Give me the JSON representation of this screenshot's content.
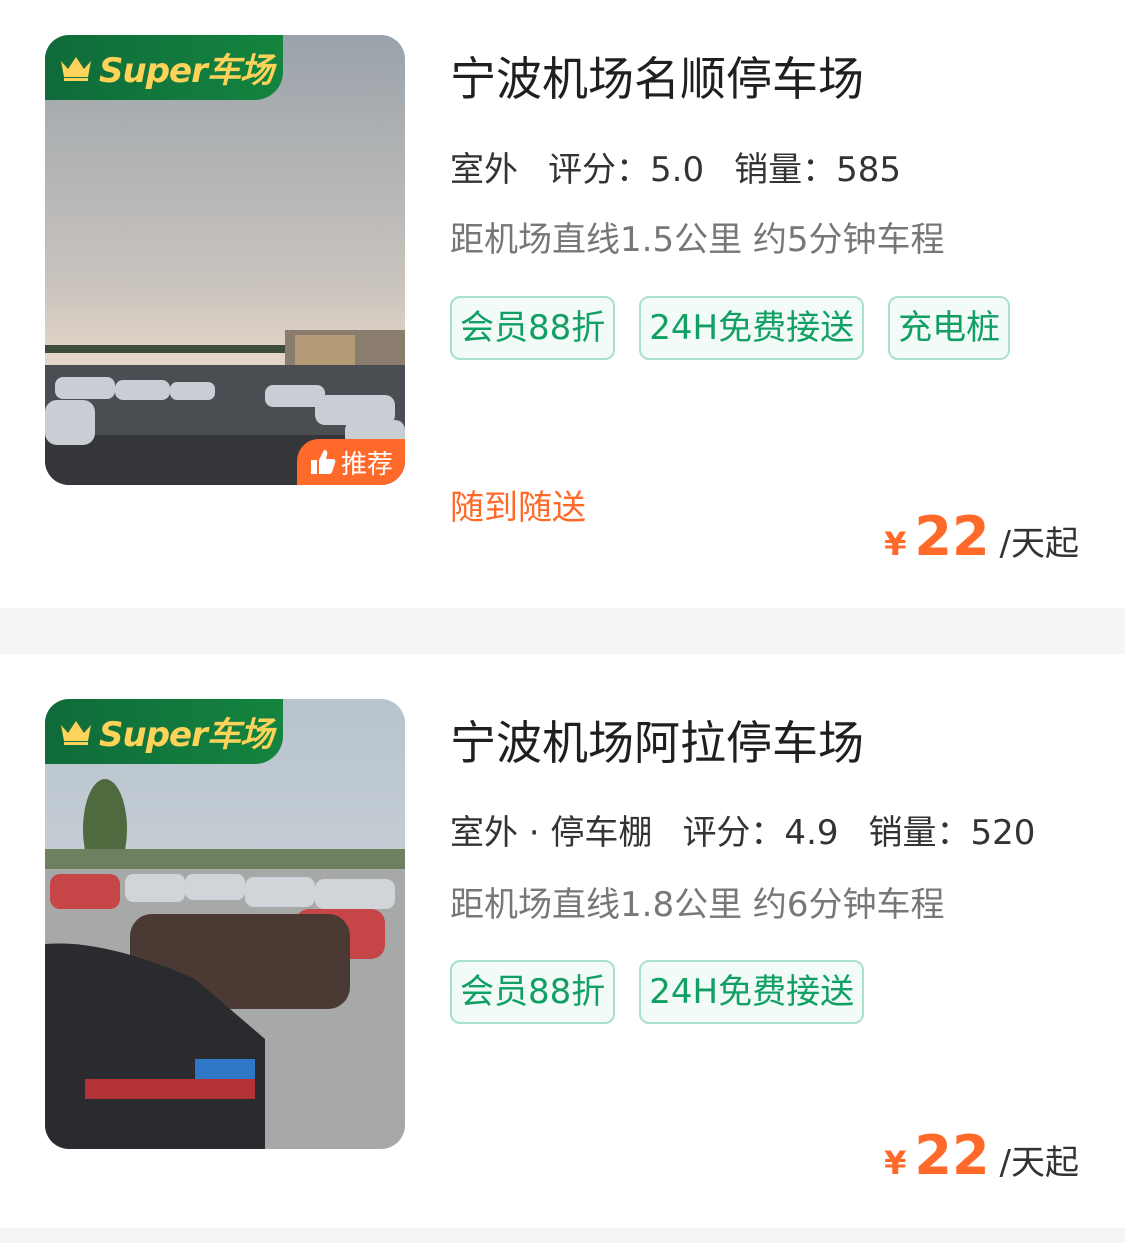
{
  "super_badge": "Super车场",
  "recommend_label": "推荐",
  "lots": [
    {
      "name": "宁波机场名顺停车场",
      "type_tag": "室外",
      "rating": "评分：5.0",
      "sales": "销量：585",
      "distance": "距机场直线1.5公里 约5分钟车程",
      "tags": [
        "会员88折",
        "24H免费接送",
        "充电桩"
      ],
      "service_note": "随到随送",
      "price_symbol": "¥",
      "price": "22",
      "price_unit": "/天起"
    },
    {
      "name": "宁波机场阿拉停车场",
      "type_tag": "室外 · 停车棚",
      "rating": "评分：4.9",
      "sales": "销量：520",
      "distance": "距机场直线1.8公里 约6分钟车程",
      "tags": [
        "会员88折",
        "24H免费接送"
      ],
      "price_symbol": "¥",
      "price": "22",
      "price_unit": "/天起"
    }
  ],
  "colors": {
    "accent_orange": "#ff6a2b",
    "tag_green": "#11a063",
    "badge_green": "#0f6b3a",
    "badge_gold": "#ffd35a"
  }
}
